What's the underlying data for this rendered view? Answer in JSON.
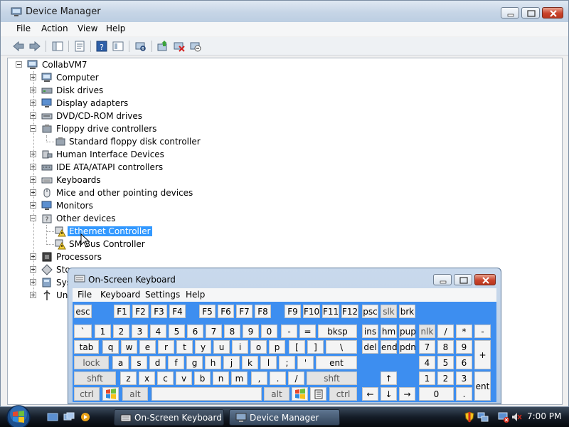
{
  "device_manager": {
    "title": "Device Manager",
    "menu": [
      "File",
      "Action",
      "View",
      "Help"
    ],
    "toolbar_icons": [
      "back-icon",
      "forward-icon",
      "show-hide-tree-icon",
      "properties-icon",
      "help-icon",
      "view-icon",
      "scan-hardware-icon",
      "update-driver-icon",
      "uninstall-icon",
      "disable-icon"
    ],
    "tree": {
      "root": "CollabVM7",
      "items": [
        {
          "label": "Computer",
          "icon": "computer-icon"
        },
        {
          "label": "Disk drives",
          "icon": "disk-drive-icon"
        },
        {
          "label": "Display adapters",
          "icon": "display-adapter-icon"
        },
        {
          "label": "DVD/CD-ROM drives",
          "icon": "dvd-drive-icon"
        },
        {
          "label": "Floppy drive controllers",
          "icon": "floppy-controller-icon"
        },
        {
          "label": "Standard floppy disk controller",
          "icon": "floppy-controller-icon"
        },
        {
          "label": "Human Interface Devices",
          "icon": "hid-icon"
        },
        {
          "label": "IDE ATA/ATAPI controllers",
          "icon": "ide-controller-icon"
        },
        {
          "label": "Keyboards",
          "icon": "keyboard-icon"
        },
        {
          "label": "Mice and other pointing devices",
          "icon": "mouse-icon"
        },
        {
          "label": "Monitors",
          "icon": "monitor-icon"
        },
        {
          "label": "Other devices",
          "icon": "other-devices-icon"
        },
        {
          "label": "Ethernet Controller",
          "icon": "warning-device-icon"
        },
        {
          "label": "SM Bus Controller",
          "icon": "warning-device-icon"
        },
        {
          "label": "Processors",
          "icon": "processor-icon"
        },
        {
          "label": "Sto",
          "icon": "storage-controller-icon"
        },
        {
          "label": "Sys",
          "icon": "system-devices-icon"
        },
        {
          "label": "Uni",
          "icon": "usb-controller-icon"
        }
      ]
    }
  },
  "osk": {
    "title": "On-Screen Keyboard",
    "menu": [
      "File",
      "Keyboard",
      "Settings",
      "Help"
    ],
    "keys": {
      "esc": "esc",
      "f1": "F1",
      "f2": "F2",
      "f3": "F3",
      "f4": "F4",
      "f5": "F5",
      "f6": "F6",
      "f7": "F7",
      "f8": "F8",
      "f9": "F9",
      "f10": "F10",
      "f11": "F11",
      "f12": "F12",
      "psc": "psc",
      "slk": "slk",
      "brk": "brk",
      "backtick": "`",
      "n1": "1",
      "n2": "2",
      "n3": "3",
      "n4": "4",
      "n5": "5",
      "n6": "6",
      "n7": "7",
      "n8": "8",
      "n9": "9",
      "n0": "0",
      "minus": "-",
      "equals": "=",
      "bksp": "bksp",
      "ins": "ins",
      "hm": "hm",
      "pup": "pup",
      "nlk": "nlk",
      "slash": "/",
      "star": "*",
      "npminus": "-",
      "tab": "tab",
      "q": "q",
      "w": "w",
      "e": "e",
      "r": "r",
      "t": "t",
      "y": "y",
      "u": "u",
      "i": "i",
      "o": "o",
      "p": "p",
      "lbracket": "[",
      "rbracket": "]",
      "backslash": "\\",
      "del": "del",
      "end": "end",
      "pdn": "pdn",
      "np7": "7",
      "np8": "8",
      "np9": "9",
      "plus": "+",
      "lock": "lock",
      "a": "a",
      "s": "s",
      "d": "d",
      "f": "f",
      "g": "g",
      "h": "h",
      "j": "j",
      "k": "k",
      "l": "l",
      "semicolon": ";",
      "quote": "'",
      "ent": "ent",
      "np4": "4",
      "np5": "5",
      "np6": "6",
      "lshft": "shft",
      "z": "z",
      "x": "x",
      "c": "c",
      "v": "v",
      "b": "b",
      "n": "n",
      "m": "m",
      "comma": ",",
      "period": ".",
      "fslash": "/",
      "rshft": "shft",
      "up": "↑",
      "np1": "1",
      "np2": "2",
      "np3": "3",
      "lctrl": "ctrl",
      "lalt": "alt",
      "ralt": "alt",
      "rctrl": "ctrl",
      "left": "←",
      "down": "↓",
      "right": "→",
      "np0": "0",
      "npdot": ".",
      "npent": "ent"
    }
  },
  "taskbar": {
    "tasks": [
      "On-Screen Keyboard",
      "Device Manager"
    ],
    "clock": "7:00 PM"
  }
}
